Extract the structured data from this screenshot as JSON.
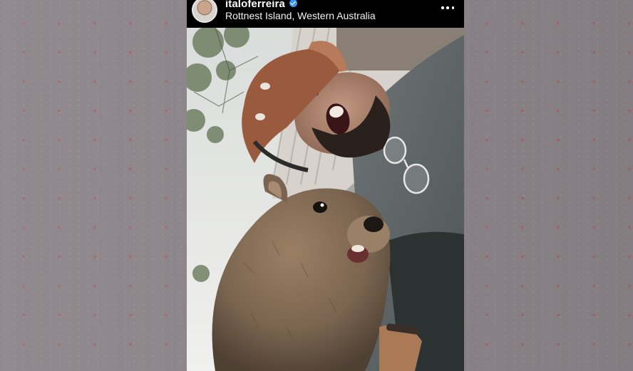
{
  "post": {
    "username": "italoferreira",
    "verified": true,
    "location": "Rottnest Island, Western Australia",
    "more_icon": "more-horizontal-icon",
    "verified_icon": "verified-badge-icon"
  },
  "colors": {
    "verified_blue": "#3897f0",
    "header_background": "#000000",
    "backdrop_dot": "#be4650"
  }
}
